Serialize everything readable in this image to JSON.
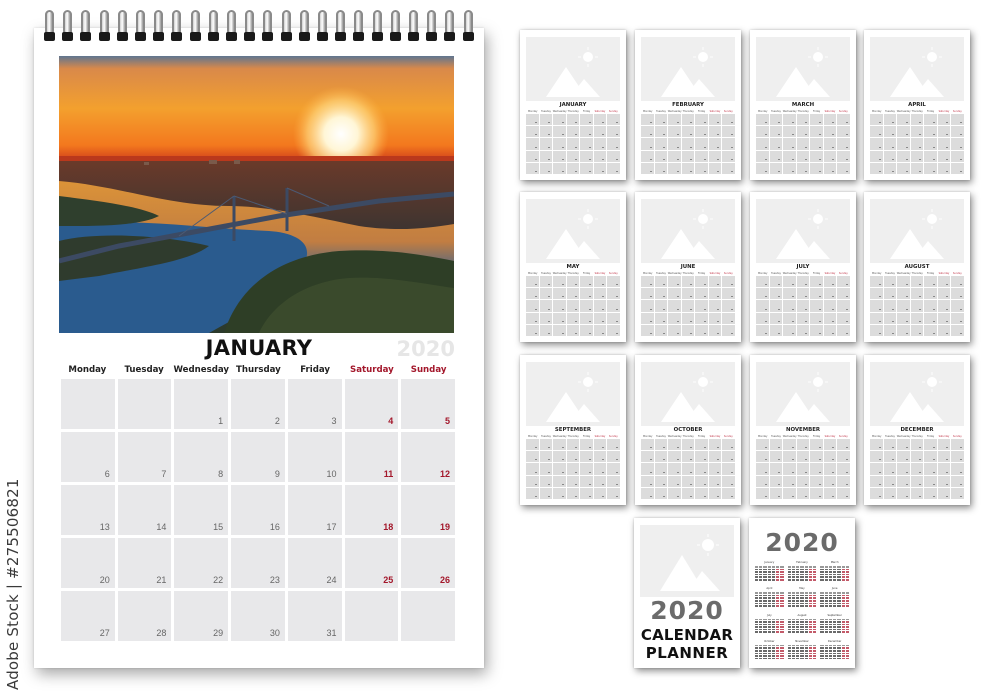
{
  "credit": "Adobe Stock | #275506821",
  "main_calendar": {
    "month": "JANUARY",
    "year": "2020",
    "weekdays": [
      {
        "label": "Monday",
        "weekend": false
      },
      {
        "label": "Tuesday",
        "weekend": false
      },
      {
        "label": "Wednesday",
        "weekend": false
      },
      {
        "label": "Thursday",
        "weekend": false
      },
      {
        "label": "Friday",
        "weekend": false
      },
      {
        "label": "Saturday",
        "weekend": true
      },
      {
        "label": "Sunday",
        "weekend": true
      }
    ],
    "weeks": [
      [
        "",
        "",
        "1",
        "2",
        "3",
        "4",
        "5"
      ],
      [
        "6",
        "7",
        "8",
        "9",
        "10",
        "11",
        "12"
      ],
      [
        "13",
        "14",
        "15",
        "16",
        "17",
        "18",
        "19"
      ],
      [
        "20",
        "21",
        "22",
        "23",
        "24",
        "25",
        "26"
      ],
      [
        "27",
        "28",
        "29",
        "30",
        "31",
        "",
        ""
      ]
    ],
    "photo_description": "sunset over river with bridge",
    "colors": {
      "weekend": "#a3172b",
      "cell": "#e8e8ea"
    }
  },
  "thumbnails": {
    "months": [
      "JANUARY",
      "FEBRUARY",
      "MARCH",
      "APRIL",
      "MAY",
      "JUNE",
      "JULY",
      "AUGUST",
      "SEPTEMBER",
      "OCTOBER",
      "NOVEMBER",
      "DECEMBER"
    ],
    "weekdays": [
      "Monday",
      "Tuesday",
      "Wednesday",
      "Thursday",
      "Friday",
      "Saturday",
      "Sunday"
    ],
    "placeholder_icon": "image-placeholder-icon"
  },
  "cover": {
    "year": "2020",
    "line1": "CALENDAR",
    "line2": "PLANNER"
  },
  "year_overview": {
    "year": "2020",
    "months": [
      "January",
      "February",
      "March",
      "April",
      "May",
      "June",
      "July",
      "August",
      "September",
      "October",
      "November",
      "December"
    ]
  }
}
